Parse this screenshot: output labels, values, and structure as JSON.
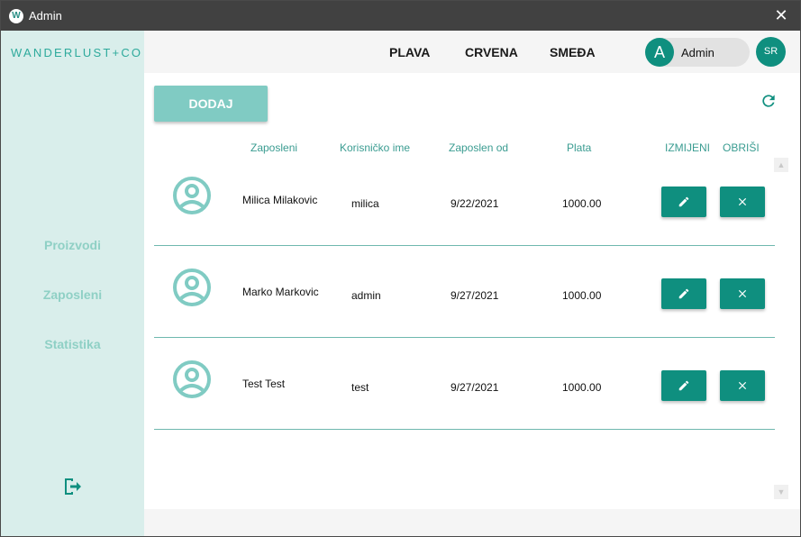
{
  "window": {
    "title": "Admin",
    "app_icon_letter": "W"
  },
  "sidebar": {
    "logo": "WANDERLUST+CO",
    "items": [
      {
        "label": "Proizvodi"
      },
      {
        "label": "Zaposleni"
      },
      {
        "label": "Statistika"
      }
    ]
  },
  "topbar": {
    "themes": [
      "PLAVA",
      "CRVENA",
      "SMEĐA"
    ],
    "user": {
      "initial": "A",
      "name": "Admin"
    },
    "language": "SR"
  },
  "toolbar": {
    "add_label": "DODAJ"
  },
  "table": {
    "columns": [
      "Zaposleni",
      "Korisničko ime",
      "Zaposlen od",
      "Plata",
      "IZMIJENI",
      "OBRIŠI"
    ],
    "rows": [
      {
        "name": "Milica Milakovic",
        "username": "milica",
        "since": "9/22/2021",
        "salary": "1000.00"
      },
      {
        "name": "Marko Markovic",
        "username": "admin",
        "since": "9/27/2021",
        "salary": "1000.00"
      },
      {
        "name": "Test Test",
        "username": "test",
        "since": "9/27/2021",
        "salary": "1000.00"
      }
    ]
  },
  "colors": {
    "accent": "#0f8f7f",
    "accent_light": "#80cbc3",
    "sidebar_bg": "#d9eeeb",
    "titlebar_bg": "#414141"
  },
  "icons": {
    "row_avatar": "account-circle-icon",
    "edit": "pencil-icon",
    "delete": "close-icon",
    "refresh": "refresh-icon",
    "logout": "logout-icon"
  }
}
